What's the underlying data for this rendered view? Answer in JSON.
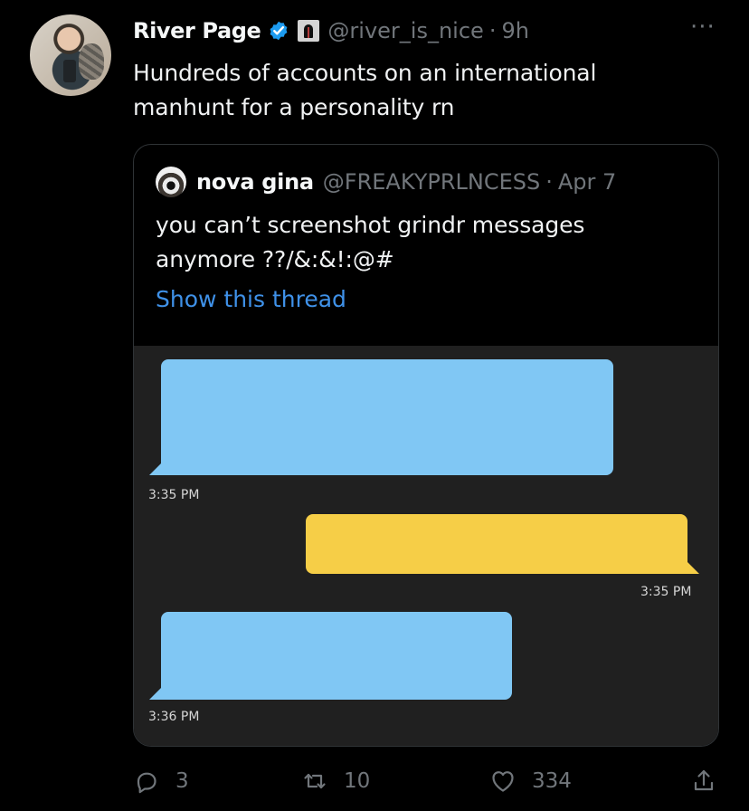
{
  "tweet": {
    "author": {
      "name": "River Page",
      "handle": "@river_is_nice",
      "time": "9h",
      "separator": "·"
    },
    "more_label": "···",
    "text_lines": [
      "Hundreds of accounts on an international",
      "manhunt for a personality rn"
    ]
  },
  "quote": {
    "author": {
      "name": "nova gina",
      "handle": "@FREAKYPRLNCESS",
      "separator": "·",
      "date": "Apr 7"
    },
    "text_lines": [
      "you can’t screenshot grindr messages",
      "anymore ??/&:&!:@#"
    ],
    "show_thread": "Show this thread",
    "chat": {
      "colors": {
        "background": "#202020",
        "incoming": "#80c7f4",
        "outgoing": "#f6ce47"
      },
      "timestamps": [
        "3:35 PM",
        "3:35 PM",
        "3:36 PM"
      ]
    }
  },
  "actions": {
    "replies": "3",
    "retweets": "10",
    "likes": "334"
  },
  "icons": {
    "verified": "verified-badge-icon",
    "reply": "reply-icon",
    "retweet": "retweet-icon",
    "like": "heart-icon",
    "share": "share-icon"
  },
  "colors": {
    "background": "#000000",
    "text": "#e7e9ea",
    "muted": "#71767b",
    "link": "#3f91e8",
    "verified": "#1d9bf0"
  }
}
